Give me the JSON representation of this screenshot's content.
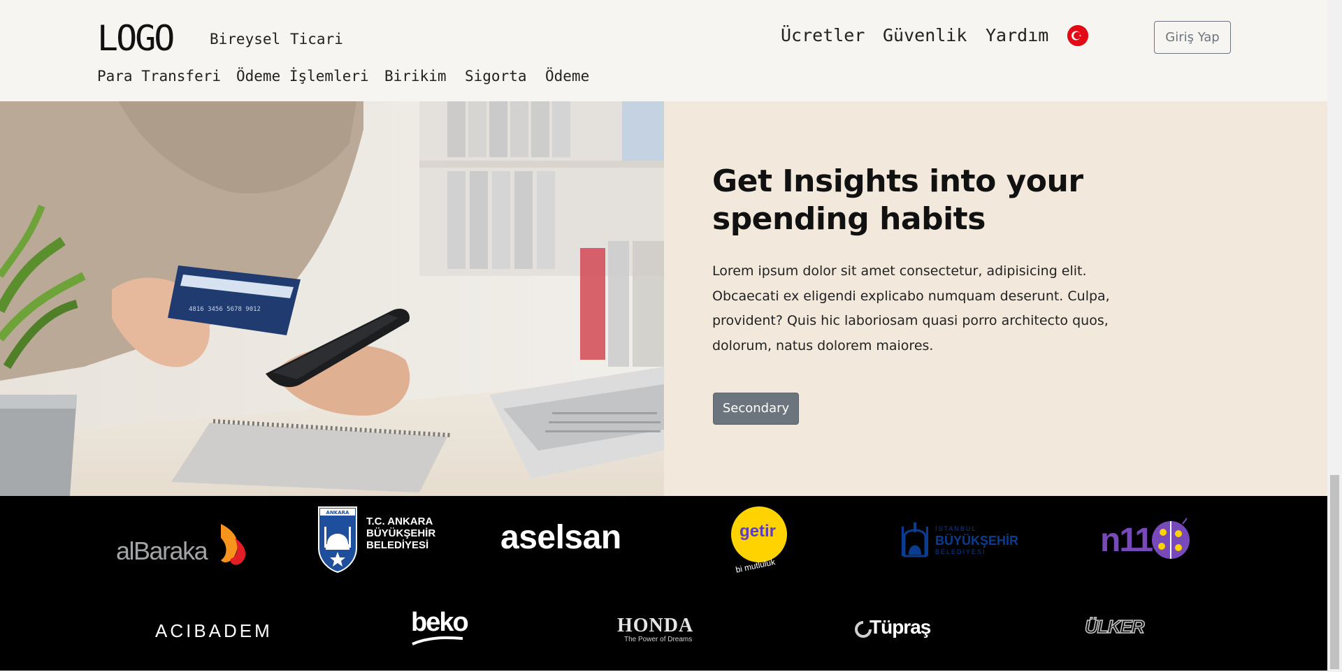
{
  "header": {
    "logo": "LOGO",
    "segments": [
      "Bireysel",
      "Ticari"
    ],
    "top_nav": [
      "Ücretler",
      "Güvenlik",
      "Yardım"
    ],
    "language_flag": "turkey-flag-icon",
    "login_label": "Giriş Yap",
    "sub_nav": [
      "Para Transferi",
      "Ödeme İşlemleri",
      "Birikim",
      "Sigorta",
      "Ödeme"
    ]
  },
  "hero": {
    "image": "photo of hands holding a credit card and smartphone at a desk",
    "title": "Get Insights into your spending habits",
    "body": "Lorem ipsum dolor sit amet consectetur, adipisicing elit. Obcaecati ex eligendi explicabo numquam deserunt. Culpa, provident? Quis hic laboriosam quasi porro architecto quos, dolorum, natus dolorem maiores.",
    "button_label": "Secondary"
  },
  "partners": {
    "row1": [
      {
        "name": "albaraka-logo",
        "text": "alBaraka"
      },
      {
        "name": "ankara-buyuksehir-logo",
        "text": "T.C. ANKARA BÜYÜKŞEHİR BELEDİYESİ",
        "badge": "ANKARA"
      },
      {
        "name": "aselsan-logo",
        "text": "aselsan"
      },
      {
        "name": "getir-logo",
        "text": "getir",
        "tagline": "bi mutluluk"
      },
      {
        "name": "istanbul-buyuksehir-logo",
        "text": "BÜYÜKŞEHİR",
        "sub_top": "İSTANBUL",
        "sub_bottom": "BELEDİYESİ"
      },
      {
        "name": "n11-logo",
        "text": "n11"
      }
    ],
    "row2": [
      {
        "name": "acibadem-logo",
        "text": "ACIBADEM"
      },
      {
        "name": "beko-logo",
        "text": "beko"
      },
      {
        "name": "honda-logo",
        "text": "HONDA",
        "tagline": "The Power of Dreams"
      },
      {
        "name": "tupras-logo",
        "text": "Tüpraş"
      },
      {
        "name": "ulker-logo",
        "text": "ÜLKER"
      }
    ]
  },
  "colors": {
    "header_bg": "#f7f5f2",
    "hero_panel_bg": "#f2e9dc",
    "secondary": "#6c757d",
    "logos_bg": "#000000",
    "albaraka_orange": "#f7941d",
    "albaraka_red": "#e31e24",
    "getir_yellow": "#ffd300",
    "getir_purple": "#5d3ebc",
    "ibb_blue": "#0a3d91",
    "n11_purple": "#7849b8",
    "flag_red": "#e30a17"
  }
}
